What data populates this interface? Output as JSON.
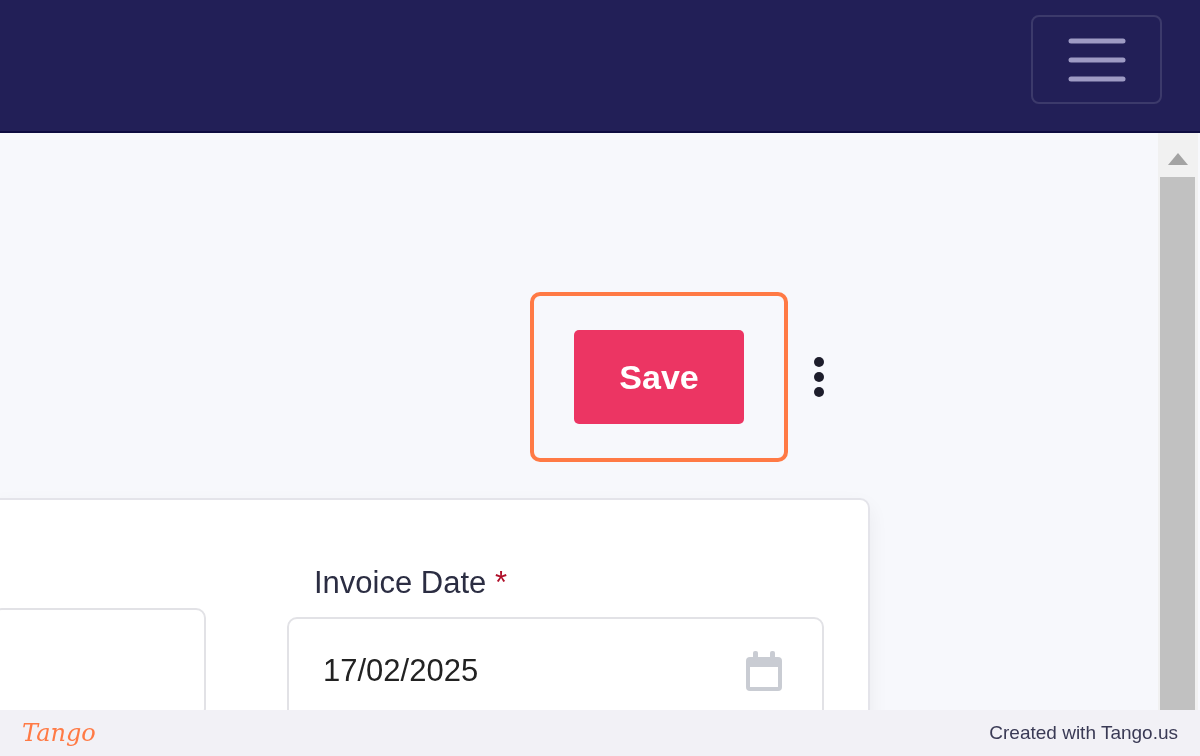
{
  "toolbar": {
    "save_button": "Save"
  },
  "form": {
    "invoice_date": {
      "label": "Invoice Date",
      "required": true,
      "required_mark": "*",
      "value": "17/02/2025"
    }
  },
  "footer": {
    "logo": "Tango",
    "credit": "Created with Tango.us"
  }
}
